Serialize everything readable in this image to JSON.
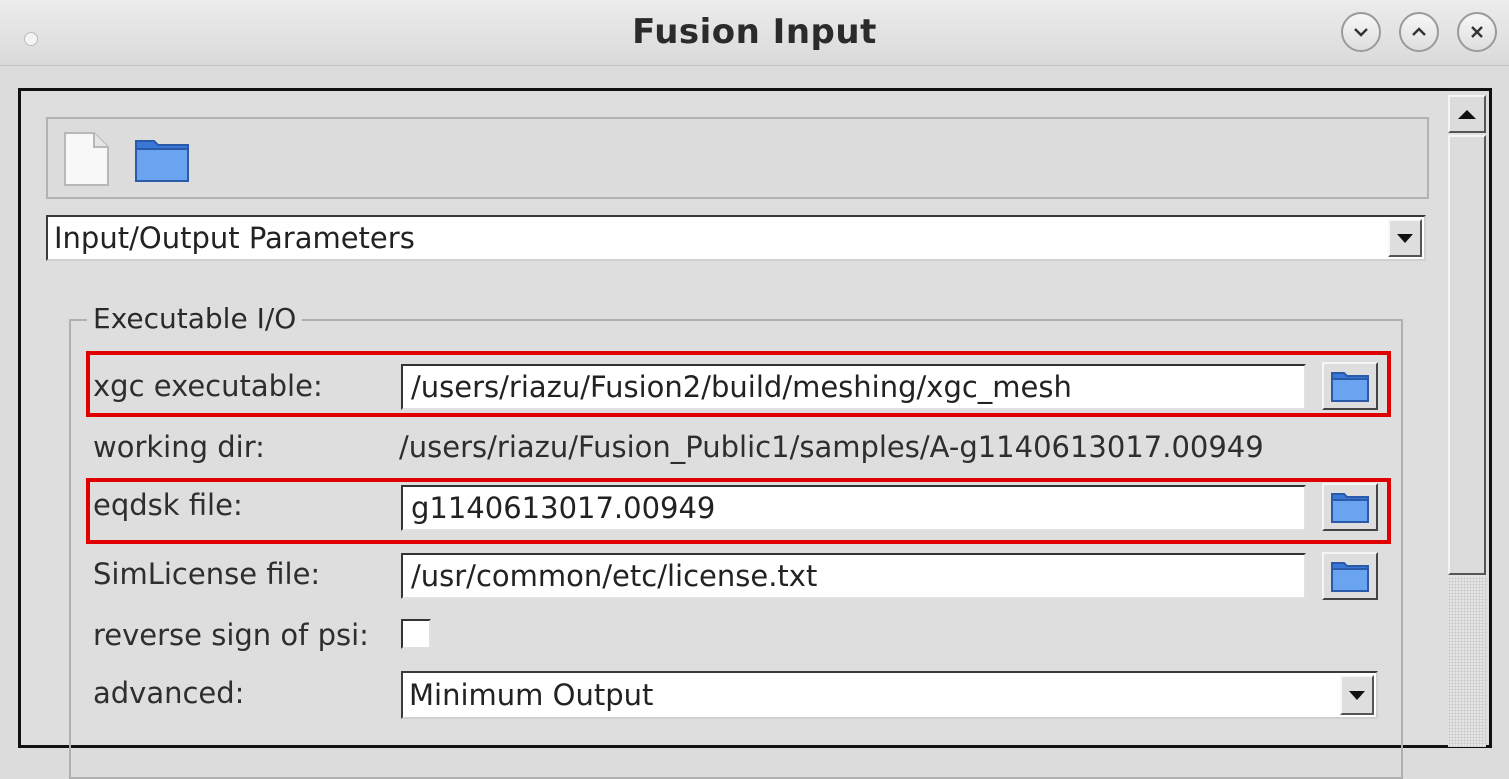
{
  "window": {
    "title": "Fusion Input",
    "controls": [
      "minimize-icon",
      "maximize-icon",
      "close-icon"
    ]
  },
  "toolbar": {
    "icons": [
      "new-file-icon",
      "open-folder-icon"
    ]
  },
  "section_select": {
    "value": "Input/Output Parameters"
  },
  "group": {
    "title": "Executable I/O",
    "rows": {
      "xgc_executable": {
        "label": "xgc executable:",
        "value": "/users/riazu/Fusion2/build/meshing/xgc_mesh",
        "highlighted": true
      },
      "working_dir": {
        "label": "working dir:",
        "value": "/users/riazu/Fusion_Public1/samples/A-g1140613017.00949"
      },
      "eqdsk_file": {
        "label": "eqdsk file:",
        "value": "g1140613017.00949",
        "highlighted": true
      },
      "simlicense_file": {
        "label": "SimLicense file:",
        "value": "/usr/common/etc/license.txt"
      },
      "reverse_psi": {
        "label": "reverse sign of psi:",
        "checked": false
      },
      "advanced": {
        "label": "advanced:",
        "value": "Minimum Output"
      }
    }
  },
  "colors": {
    "highlight": "#e00000",
    "folder": "#3a78d8"
  }
}
